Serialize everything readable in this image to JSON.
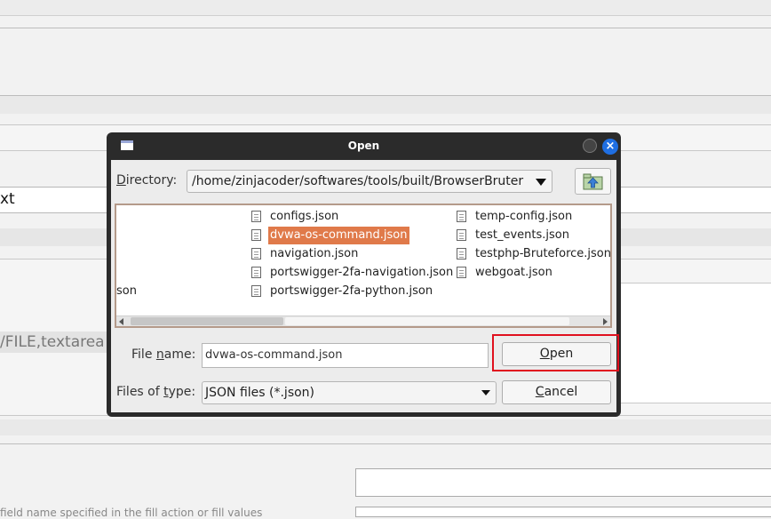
{
  "background": {
    "field_text": "xt",
    "textarea_label": "/FILE,textarea",
    "bottom_text": "field name specified in the fill action or fill values"
  },
  "dialog": {
    "title": "Open",
    "close_symbol": "×",
    "directory_label_u": "D",
    "directory_label_rest": "irectory:",
    "directory_path": "/home/zinjacoder/softwares/tools/built/BrowserBruter",
    "files": [
      {
        "name": "configs.json",
        "selected": false
      },
      {
        "name": "dvwa-os-command.json",
        "selected": true
      },
      {
        "name": "navigation.json",
        "selected": false
      },
      {
        "name": "portswigger-2fa-navigation.json",
        "selected": false
      },
      {
        "name": "portswigger-2fa-python.json",
        "selected": false
      },
      {
        "name": "temp-config.json",
        "selected": false
      },
      {
        "name": "test_events.json",
        "selected": false
      },
      {
        "name": "testphp-Bruteforce.json",
        "selected": false
      },
      {
        "name": "webgoat.json",
        "selected": false
      }
    ],
    "partial_file": "son",
    "file_name_label_a": "File ",
    "file_name_label_u": "n",
    "file_name_label_b": "ame:",
    "file_name_value": "dvwa-os-command.json",
    "files_of_type_label_a": "Files of ",
    "files_of_type_label_u": "t",
    "files_of_type_label_b": "ype:",
    "files_of_type_value": "JSON files (*.json)",
    "open_button_u": "O",
    "open_button_rest": "pen",
    "cancel_button_u": "C",
    "cancel_button_rest": "ancel"
  },
  "colors": {
    "selection": "#e07a4a",
    "highlight_box": "#e0101e",
    "close_button": "#1f6fe3"
  },
  "icons": [
    "window-icon",
    "minimize-icon",
    "close-icon",
    "up-folder-icon",
    "document-icon",
    "dropdown-arrow-icon"
  ]
}
